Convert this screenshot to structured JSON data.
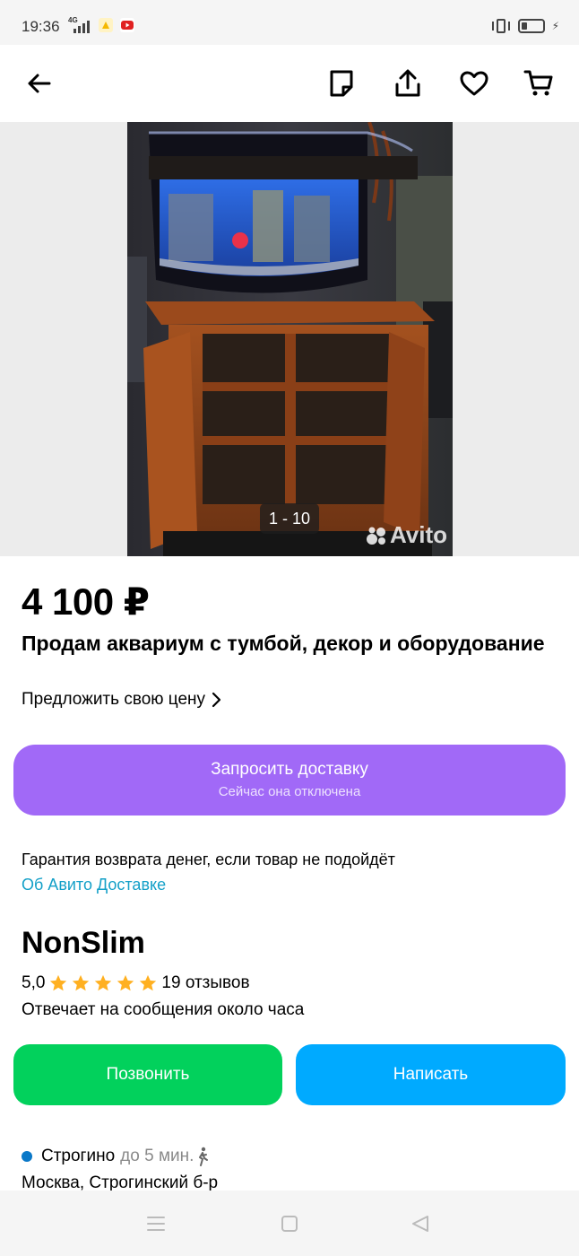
{
  "status_bar": {
    "time": "19:36",
    "network": "4G",
    "battery_level": 0.25
  },
  "toolbar": {
    "back_icon": "arrow-left-icon",
    "note_icon": "note-icon",
    "share_icon": "share-icon",
    "favorite_icon": "heart-icon",
    "cart_icon": "cart-icon"
  },
  "gallery": {
    "counter": "1 - 10",
    "watermark": "Avito"
  },
  "listing": {
    "price": "4 100 ₽",
    "title": "Продам аквариум с тумбой, декор и оборудование",
    "offer_price_label": "Предложить свою цену"
  },
  "delivery": {
    "button_label": "Запросить доставку",
    "button_sublabel": "Сейчас она отключена",
    "guarantee_text": "Гарантия возврата денег, если товар не подойдёт",
    "about_link": "Об Авито Доставке"
  },
  "seller": {
    "name": "NonSlim",
    "rating": "5,0",
    "stars": 5,
    "reviews": "19 отзывов",
    "reply_time": "Отвечает на сообщения около часа"
  },
  "actions": {
    "call_label": "Позвонить",
    "message_label": "Написать"
  },
  "location": {
    "metro": "Строгино",
    "walk_time": "до 5 мин.",
    "address": "Москва, Строгинский б-р"
  },
  "colors": {
    "delivery_button": "#a169f7",
    "call_button": "#02d15c",
    "message_button": "#00aaff",
    "link": "#14a0c8",
    "star": "#ffb021",
    "metro_dot": "#0a78c8"
  }
}
